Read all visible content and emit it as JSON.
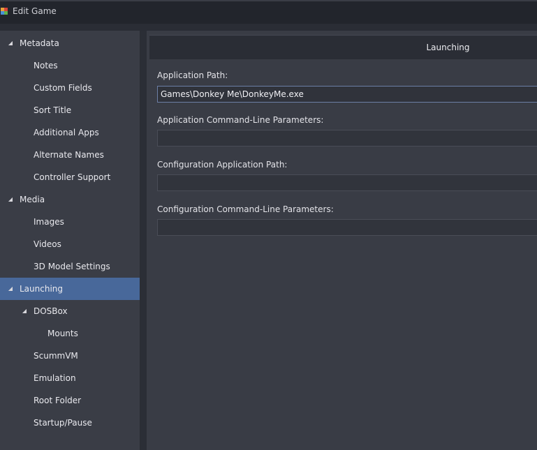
{
  "window": {
    "title": "Edit Game"
  },
  "sidebar": {
    "items": [
      {
        "label": "Metadata",
        "level": 0,
        "expanded": true,
        "selected": false
      },
      {
        "label": "Notes",
        "level": 1,
        "selected": false
      },
      {
        "label": "Custom Fields",
        "level": 1,
        "selected": false
      },
      {
        "label": "Sort Title",
        "level": 1,
        "selected": false
      },
      {
        "label": "Additional Apps",
        "level": 1,
        "selected": false
      },
      {
        "label": "Alternate Names",
        "level": 1,
        "selected": false
      },
      {
        "label": "Controller Support",
        "level": 1,
        "selected": false
      },
      {
        "label": "Media",
        "level": 0,
        "expanded": true,
        "selected": false
      },
      {
        "label": "Images",
        "level": 1,
        "selected": false
      },
      {
        "label": "Videos",
        "level": 1,
        "selected": false
      },
      {
        "label": "3D Model Settings",
        "level": 1,
        "selected": false
      },
      {
        "label": "Launching",
        "level": 0,
        "expanded": true,
        "selected": true
      },
      {
        "label": "DOSBox",
        "level": 1,
        "expanded": true,
        "selected": false
      },
      {
        "label": "Mounts",
        "level": 2,
        "selected": false
      },
      {
        "label": "ScummVM",
        "level": 1,
        "selected": false
      },
      {
        "label": "Emulation",
        "level": 1,
        "selected": false
      },
      {
        "label": "Root Folder",
        "level": 1,
        "selected": false
      },
      {
        "label": "Startup/Pause",
        "level": 1,
        "selected": false
      }
    ]
  },
  "main": {
    "section_title": "Launching",
    "fields": {
      "app_path": {
        "label": "Application Path:",
        "value": "Games\\Donkey Me\\DonkeyMe.exe"
      },
      "app_params": {
        "label": "Application Command-Line Parameters:",
        "value": ""
      },
      "config_path": {
        "label": "Configuration Application Path:",
        "value": ""
      },
      "config_params": {
        "label": "Configuration Command-Line Parameters:",
        "value": ""
      }
    }
  },
  "colors": {
    "selected_bg": "#48689a",
    "sidebar_bg": "#3a3d46",
    "main_bg": "#393c45"
  }
}
